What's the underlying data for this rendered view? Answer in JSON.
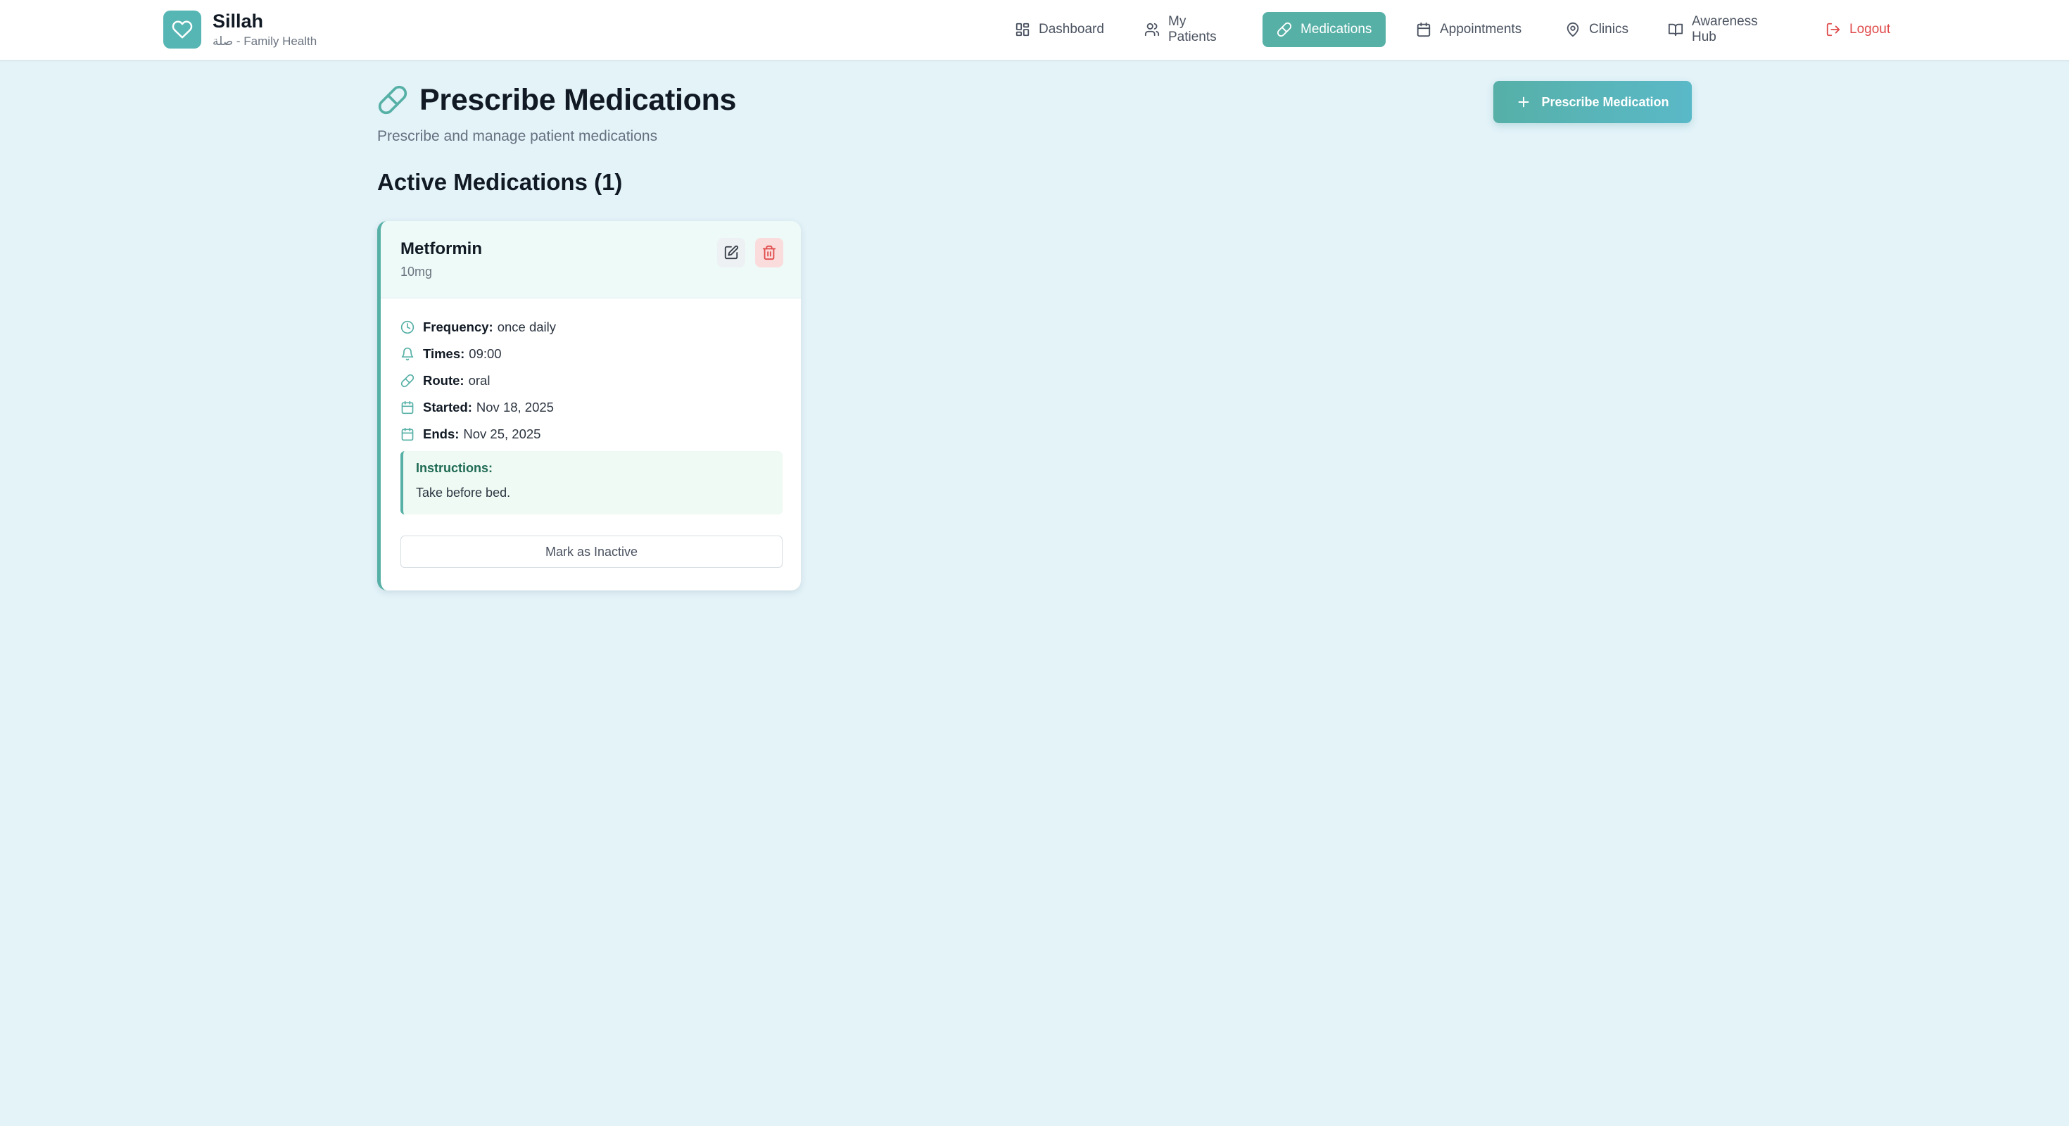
{
  "brand": {
    "name": "Sillah",
    "subtitle": "صلة - Family Health",
    "color": "#56b6b4"
  },
  "nav": {
    "items": [
      {
        "label": "Dashboard",
        "icon": "dashboard-grid-icon"
      },
      {
        "label": "My Patients",
        "icon": "users-icon"
      },
      {
        "label": "Medications",
        "icon": "pill-icon",
        "active": true
      },
      {
        "label": "Appointments",
        "icon": "calendar-icon"
      },
      {
        "label": "Clinics",
        "icon": "map-pin-icon"
      },
      {
        "label": "Awareness Hub",
        "icon": "book-open-icon"
      }
    ],
    "logout_label": "Logout"
  },
  "page": {
    "title": "Prescribe Medications",
    "subtitle": "Prescribe and manage patient medications",
    "prescribe_button_label": "Prescribe Medication"
  },
  "section": {
    "title": "Active Medications (1)"
  },
  "medication": {
    "name": "Metformin",
    "dose": "10mg",
    "details": [
      {
        "label": "Frequency:",
        "value": "once daily",
        "icon": "clock-icon"
      },
      {
        "label": "Times:",
        "value": "09:00",
        "icon": "bell-icon"
      },
      {
        "label": "Route:",
        "value": "oral",
        "icon": "pill-icon"
      },
      {
        "label": "Started:",
        "value": "Nov 18, 2025",
        "icon": "calendar-icon"
      },
      {
        "label": "Ends:",
        "value": "Nov 25, 2025",
        "icon": "calendar-icon"
      }
    ],
    "instructions_label": "Instructions:",
    "instructions_text": "Take before bed.",
    "mark_inactive_label": "Mark as Inactive"
  },
  "colors": {
    "accent": "#56b0a6",
    "background": "#e3f3f8",
    "danger": "#e04b4b"
  }
}
